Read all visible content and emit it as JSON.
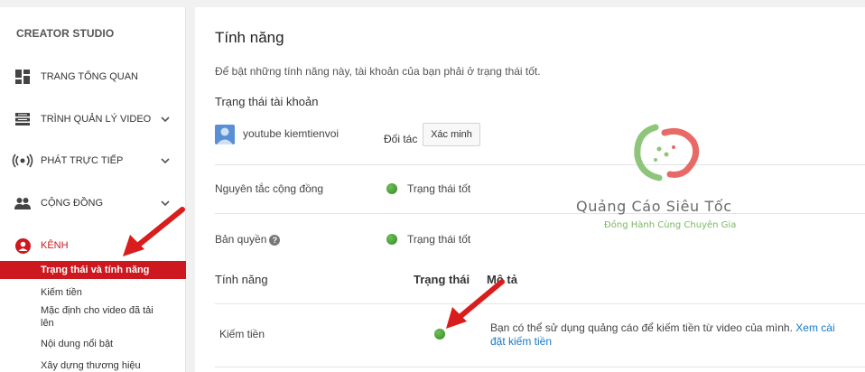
{
  "sidebar": {
    "title": "CREATOR STUDIO",
    "items": [
      {
        "label": "TRANG TỔNG QUAN",
        "icon": "dashboard-icon"
      },
      {
        "label": "TRÌNH QUẢN LÝ VIDEO",
        "icon": "video-manager-icon"
      },
      {
        "label": "PHÁT TRỰC TIẾP",
        "icon": "live-icon"
      },
      {
        "label": "CỘNG ĐỒNG",
        "icon": "community-icon"
      },
      {
        "label": "KÊNH",
        "icon": "channel-icon"
      }
    ],
    "sub_items": [
      "Trạng thái và tính năng",
      "Kiếm tiền",
      "Mặc định cho video đã tải lên",
      "Nội dung nổi bật",
      "Xây dựng thương hiệu"
    ]
  },
  "main": {
    "title": "Tính năng",
    "intro": "Để bật những tính năng này, tài khoản của bạn phải ở trạng thái tốt.",
    "account_status_title": "Trạng thái tài khoản",
    "account_name": "youtube kiemtienvoi",
    "partner_label": "Đối tác",
    "verify_button": "Xác minh",
    "community_label": "Nguyên tắc cộng đồng",
    "community_status": "Trạng thái tốt",
    "copyright_label": "Bản quyền",
    "copyright_status": "Trạng thái tốt",
    "table_headers": [
      "Tính năng",
      "Trạng thái",
      "Mô tả"
    ],
    "feature_name": "Kiếm tiền",
    "feature_desc": "Bạn có thể sử dụng quảng cáo để kiếm tiền từ video của mình.",
    "feature_link": "Xem cài đặt kiếm tiền"
  },
  "watermark": {
    "name": "Quảng Cáo Siêu Tốc",
    "tagline": "Đồng Hành Cùng Chuyên Gia"
  },
  "colors": {
    "accent": "#cc181e",
    "status_good": "#3c9a2a",
    "link": "#167ac6"
  }
}
